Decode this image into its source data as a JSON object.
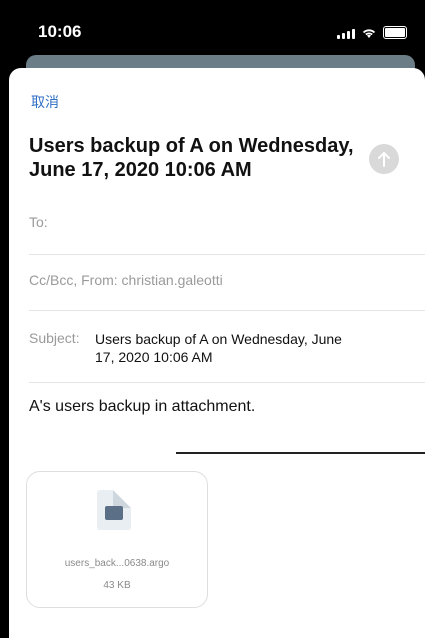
{
  "status_bar": {
    "time": "10:06"
  },
  "compose": {
    "cancel_label": "取消",
    "title": "Users backup of A on Wednesday, June 17, 2020 10:06 AM",
    "to_label": "To:",
    "cc_from_label": "Cc/Bcc, From: christian.galeotti",
    "subject_label": "Subject:",
    "subject_value": "Users backup of A on Wednesday, June 17, 2020 10:06 AM",
    "body": "A's users backup in attachment."
  },
  "attachment": {
    "file_name": "users_back...0638.argo",
    "file_size": "43 KB"
  },
  "colors": {
    "accent": "#2f6fc4",
    "send_disabled": "#d9d9d9"
  }
}
